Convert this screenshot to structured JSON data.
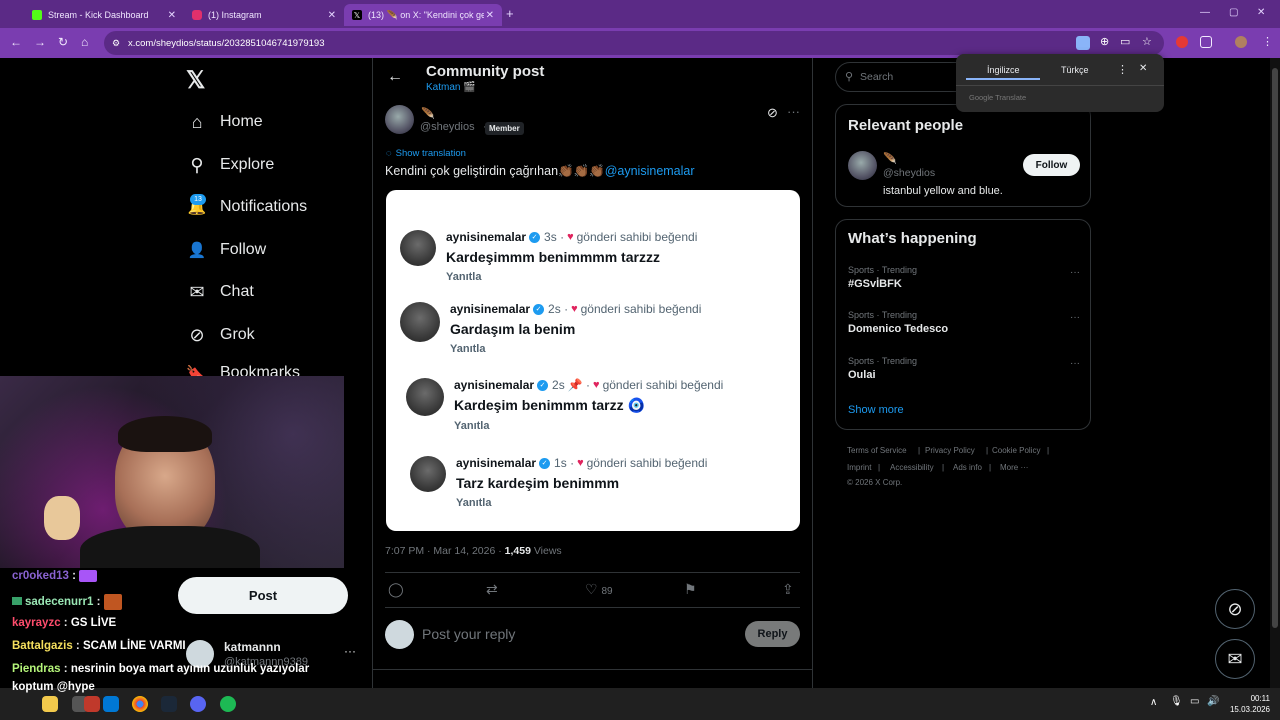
{
  "browser": {
    "tabs": [
      {
        "label": "Stream - Kick Dashboard",
        "favicon_color": "#53fc18",
        "active": false
      },
      {
        "label": "(1) Instagram",
        "favicon_color": "#e1306c",
        "active": false
      },
      {
        "label": "(13) 🪶 on X: \"Kendini çok geliş",
        "favicon_color": "#000000",
        "active": true
      }
    ],
    "url": "x.com/sheydios/status/2032851046741979193",
    "theme_color": "#7a3db0"
  },
  "sidebar": {
    "logo": "𝕏",
    "items": [
      {
        "label": "Home",
        "icon": "home-icon",
        "glyph": "⌂"
      },
      {
        "label": "Explore",
        "icon": "search-icon",
        "glyph": "⚲"
      },
      {
        "label": "Notifications",
        "icon": "bell-icon",
        "glyph": "🔔"
      },
      {
        "label": "Follow",
        "icon": "add-person-icon",
        "glyph": "👤"
      },
      {
        "label": "Chat",
        "icon": "mail-icon",
        "glyph": "✉"
      },
      {
        "label": "Grok",
        "icon": "grok-icon",
        "glyph": "⊘"
      },
      {
        "label": "Bookmarks",
        "icon": "bookmark-icon",
        "glyph": "🔖"
      }
    ],
    "notif_count": "13",
    "post_label": "Post",
    "account": {
      "name": "katmannn",
      "handle": "@katmannn9389"
    }
  },
  "stream_chat": [
    {
      "user": "cr0oked13",
      "sep": " :",
      "msg": "",
      "color": "#8a63d2"
    },
    {
      "user": "sadecenurr1",
      "sep": " :",
      "msg": "",
      "color": "#9ae6b4"
    },
    {
      "user": "kayrayzc",
      "sep": " :",
      "msg": "GS LİVE",
      "color": "#ff4d6d"
    },
    {
      "user": "Battalgazis",
      "sep": " :",
      "msg": "SCAM LİNE VARMI",
      "color": "#f6e05e"
    },
    {
      "user": "Piendras",
      "sep": " :",
      "msg": "nesrinin boya mart ayının uzunluk yazıyolar",
      "color": "#b5f57a"
    },
    {
      "user": "",
      "sep": "",
      "msg": "koptum @hype",
      "color": "#ffffff"
    }
  ],
  "post": {
    "header_title": "Community post",
    "community": "Katman 🎬",
    "author_emoji": "🪶",
    "author_handle": "@sheydios",
    "member_badge": "Member",
    "show_translation": "Show translation",
    "text": "Kendini çok geliştirdin çağrıhan👏🏾👏🏾👏🏾",
    "mention": "@aynisinemalar",
    "timestamp": "7:07 PM · Mar 14, 2026 ·",
    "views_count": "1,459",
    "views_label": "Views",
    "likes": "89",
    "reply_placeholder": "Post your reply",
    "reply_button": "Reply"
  },
  "screenshot_comments": [
    {
      "user": "aynisinemalar",
      "time": "3s",
      "pin": "",
      "liked": "gönderi sahibi beğendi",
      "text": "Kardeşimmm benimmmm tarzzz",
      "reply": "Yanıtla"
    },
    {
      "user": "aynisinemalar",
      "time": "2s",
      "pin": "",
      "liked": "gönderi sahibi beğendi",
      "text": "Gardaşım la benim",
      "reply": "Yanıtla"
    },
    {
      "user": "aynisinemalar",
      "time": "2s",
      "pin": "📌",
      "liked": "gönderi sahibi beğendi",
      "text": "Kardeşim benimmm tarzz 🧿",
      "reply": "Yanıtla"
    },
    {
      "user": "aynisinemalar",
      "time": "1s",
      "pin": "",
      "liked": "gönderi sahibi beğendi",
      "text": "Tarz kardeşim benimmm",
      "reply": "Yanıtla"
    }
  ],
  "right": {
    "search_placeholder": "Search",
    "relevant_title": "Relevant people",
    "relevant_person": {
      "emoji": "🪶",
      "handle": "@sheydios",
      "bio": "istanbul yellow and blue.",
      "follow": "Follow"
    },
    "happening_title": "What’s happening",
    "trends": [
      {
        "category": "Sports · Trending",
        "name": "#GSvİBFK"
      },
      {
        "category": "Sports · Trending",
        "name": "Domenico Tedesco"
      },
      {
        "category": "Sports · Trending",
        "name": "Oulai"
      }
    ],
    "show_more": "Show more",
    "footer": [
      "Terms of Service",
      "Privacy Policy",
      "Cookie Policy",
      "Imprint",
      "Accessibility",
      "Ads info",
      "More ···",
      "© 2026 X Corp."
    ]
  },
  "translate_popup": {
    "tab_active": "İngilizce",
    "tab_other": "Türkçe",
    "brand": "Google Translate"
  },
  "taskbar": {
    "time": "00:11",
    "date": "15.03.2026"
  }
}
